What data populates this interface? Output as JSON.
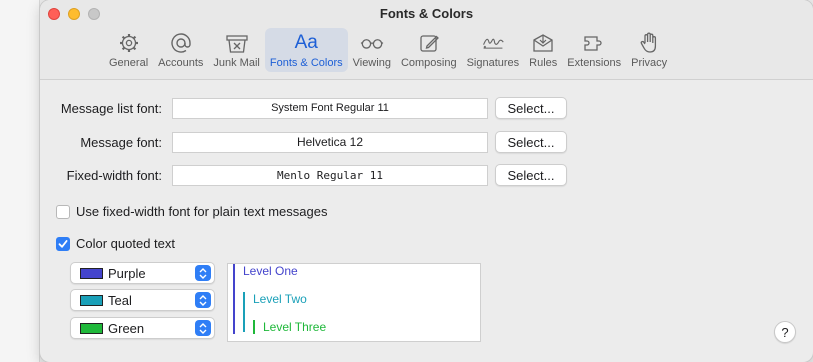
{
  "window": {
    "title": "Fonts & Colors"
  },
  "tabs": [
    {
      "label": "General",
      "icon": "gear-icon"
    },
    {
      "label": "Accounts",
      "icon": "at-icon"
    },
    {
      "label": "Junk Mail",
      "icon": "junk-mail-icon"
    },
    {
      "label": "Fonts & Colors",
      "icon": "fonts-icon",
      "glyph": "Aa",
      "active": true
    },
    {
      "label": "Viewing",
      "icon": "glasses-icon"
    },
    {
      "label": "Composing",
      "icon": "compose-icon"
    },
    {
      "label": "Signatures",
      "icon": "signature-icon"
    },
    {
      "label": "Rules",
      "icon": "rules-icon"
    },
    {
      "label": "Extensions",
      "icon": "extensions-icon"
    },
    {
      "label": "Privacy",
      "icon": "hand-icon"
    }
  ],
  "fonts": {
    "message_list": {
      "label": "Message list font:",
      "value": "System Font Regular 11",
      "button": "Select..."
    },
    "message": {
      "label": "Message font:",
      "value": "Helvetica 12",
      "button": "Select..."
    },
    "fixed_width": {
      "label": "Fixed-width font:",
      "value": "Menlo Regular 11",
      "button": "Select..."
    }
  },
  "options": {
    "fixed_width_plain": {
      "label": "Use fixed-width font for plain text messages",
      "checked": false
    },
    "color_quoted": {
      "label": "Color quoted text",
      "checked": true
    }
  },
  "quote_colors": [
    {
      "name": "Purple",
      "color": "#4444cc"
    },
    {
      "name": "Teal",
      "color": "#1aa0b8"
    },
    {
      "name": "Green",
      "color": "#1fb83a"
    }
  ],
  "preview": {
    "level_one": "Level One",
    "level_two": "Level Two",
    "level_three": "Level Three"
  },
  "help": {
    "label": "?"
  }
}
